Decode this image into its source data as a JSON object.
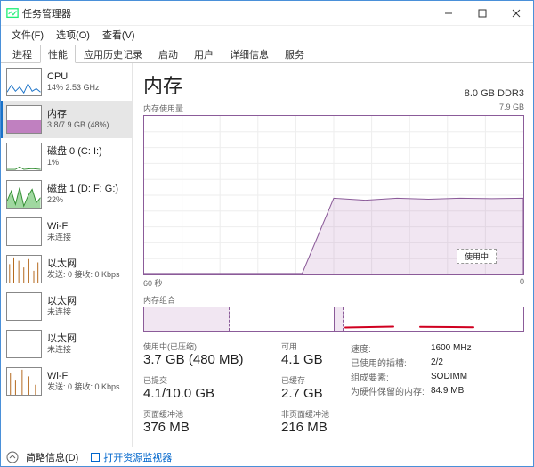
{
  "window": {
    "title": "任务管理器",
    "menus": [
      "文件(F)",
      "选项(O)",
      "查看(V)"
    ],
    "tabs": [
      "进程",
      "性能",
      "应用历史记录",
      "启动",
      "用户",
      "详细信息",
      "服务"
    ],
    "active_tab": 1
  },
  "sidebar": {
    "items": [
      {
        "name": "CPU",
        "detail": "14% 2.53 GHz",
        "kind": "cpu"
      },
      {
        "name": "内存",
        "detail": "3.8/7.9 GB (48%)",
        "kind": "mem"
      },
      {
        "name": "磁盘 0 (C: I:)",
        "detail": "1%",
        "kind": "disk"
      },
      {
        "name": "磁盘 1 (D: F: G:)",
        "detail": "22%",
        "kind": "disk"
      },
      {
        "name": "Wi-Fi",
        "detail": "未连接",
        "kind": "wifi"
      },
      {
        "name": "以太网",
        "detail": "发送: 0 接收: 0 Kbps",
        "kind": "eth"
      },
      {
        "name": "以太网",
        "detail": "未连接",
        "kind": "wifi"
      },
      {
        "name": "以太网",
        "detail": "未连接",
        "kind": "wifi"
      },
      {
        "name": "Wi-Fi",
        "detail": "发送: 0 接收: 0 Kbps",
        "kind": "eth"
      }
    ],
    "selected": 1
  },
  "main": {
    "title": "内存",
    "top_right": "8.0 GB DDR3",
    "usage_label": "内存使用量",
    "usage_max": "7.9 GB",
    "x_left": "60 秒",
    "x_right": "0",
    "chart_tag": "使用中",
    "slots_label": "内存组合",
    "slot_fills": [
      45,
      5
    ],
    "stats_left": [
      {
        "lbl": "使用中(已压缩)",
        "val": "3.7 GB (480 MB)"
      },
      {
        "lbl": "已提交",
        "val": "4.1/10.0 GB"
      },
      {
        "lbl": "页面缓冲池",
        "val": "376 MB"
      }
    ],
    "stats_mid": [
      {
        "lbl": "可用",
        "val": "4.1 GB"
      },
      {
        "lbl": "已缓存",
        "val": "2.7 GB"
      },
      {
        "lbl": "非页面缓冲池",
        "val": "216 MB"
      }
    ],
    "kv": [
      {
        "k": "速度:",
        "v": "1600 MHz"
      },
      {
        "k": "已使用的插槽:",
        "v": "2/2"
      },
      {
        "k": "组成要素:",
        "v": "SODIMM"
      },
      {
        "k": "为硬件保留的内存:",
        "v": "84.9 MB"
      }
    ]
  },
  "footer": {
    "less": "简略信息(D)",
    "resmon": "打开资源监视器"
  },
  "chart_data": {
    "type": "area",
    "title": "内存使用量",
    "ylabel": "GB",
    "ylim": [
      0,
      7.9
    ],
    "x_seconds": [
      60,
      55,
      50,
      45,
      40,
      35,
      30,
      25,
      20,
      15,
      10,
      5,
      0
    ],
    "values_gb": [
      0.05,
      0.05,
      0.05,
      0.05,
      0.05,
      0.05,
      3.8,
      3.7,
      3.8,
      3.75,
      3.8,
      3.78,
      3.8
    ]
  }
}
